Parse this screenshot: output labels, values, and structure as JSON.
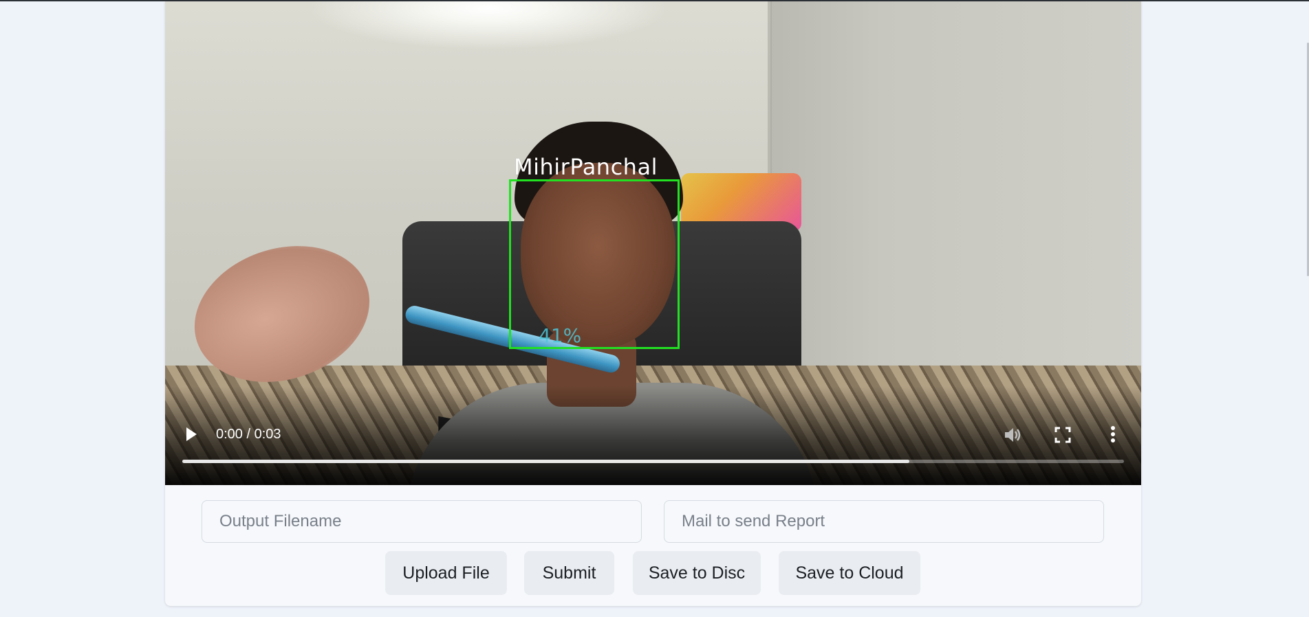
{
  "video": {
    "overlay_name": "MihirPanchal",
    "overlay_confidence": "41%",
    "time_display": "0:00 / 0:03",
    "progress_fraction": 0.772
  },
  "form": {
    "output_filename_placeholder": "Output Filename",
    "mail_placeholder": "Mail to send Report"
  },
  "buttons": {
    "upload": "Upload File",
    "submit": "Submit",
    "save_disc": "Save to Disc",
    "save_cloud": "Save to Cloud"
  },
  "colors": {
    "page_bg": "#eef2f9",
    "card_bg": "#f6f8fb",
    "button_bg": "#e9ecf1",
    "face_box": "#22e022"
  },
  "icons": [
    "play-icon",
    "volume-icon",
    "fullscreen-icon",
    "more-vert-icon"
  ]
}
